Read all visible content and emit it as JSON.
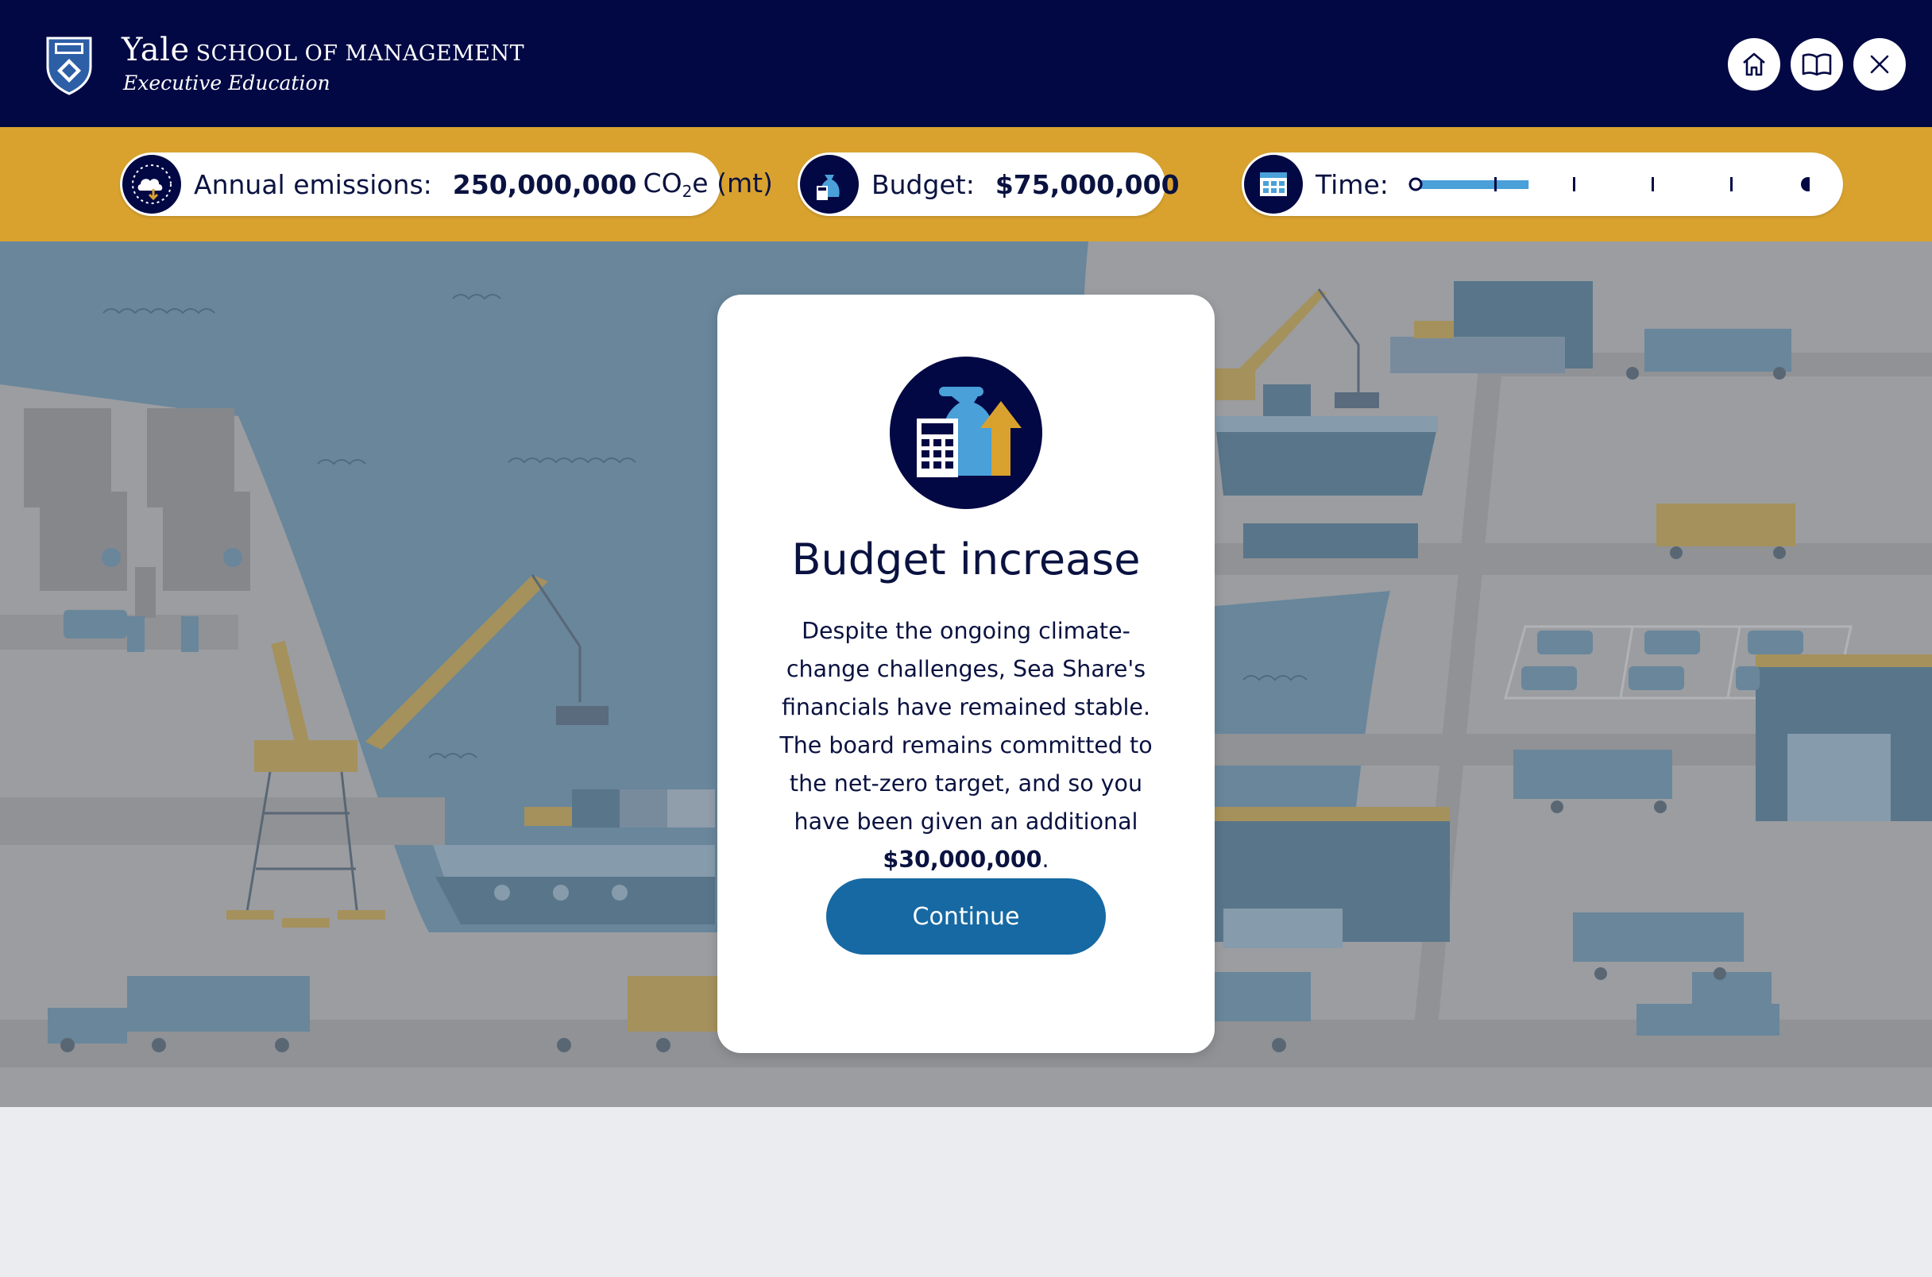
{
  "header": {
    "brand_name": "Yale",
    "brand_school": "SCHOOL OF MANAGEMENT",
    "brand_subtitle": "Executive Education",
    "buttons": [
      {
        "name": "home",
        "icon": "home-icon"
      },
      {
        "name": "guide",
        "icon": "book-icon"
      },
      {
        "name": "close",
        "icon": "close-icon"
      }
    ]
  },
  "status": {
    "emissions": {
      "label": "Annual emissions:",
      "value": "250,000,000",
      "unit_prefix": "CO",
      "unit_sub": "2",
      "unit_suffix": "e (mt)",
      "icon": "emissions-cloud-icon"
    },
    "budget": {
      "label": "Budget:",
      "value": "$75,000,000",
      "icon": "budget-moneybag-icon"
    },
    "time": {
      "label": "Time:",
      "icon": "calendar-icon",
      "progress": 0.3
    }
  },
  "modal": {
    "icon": "budget-increase-icon",
    "title": "Budget increase",
    "body_text": "Despite the ongoing climate-change challenges, Sea Share's financials have remained stable. The board remains committed to the net-zero target, and so you have been given an additional ",
    "body_amount": "$30,000,000",
    "body_end": ".",
    "continue_label": "Continue"
  },
  "colors": {
    "navy": "#020844",
    "gold": "#d9a22f",
    "accent_blue": "#1669a3",
    "timeline_blue": "#4aa0d8",
    "water": "#6e8ea3",
    "land": "#a7a8aa"
  }
}
